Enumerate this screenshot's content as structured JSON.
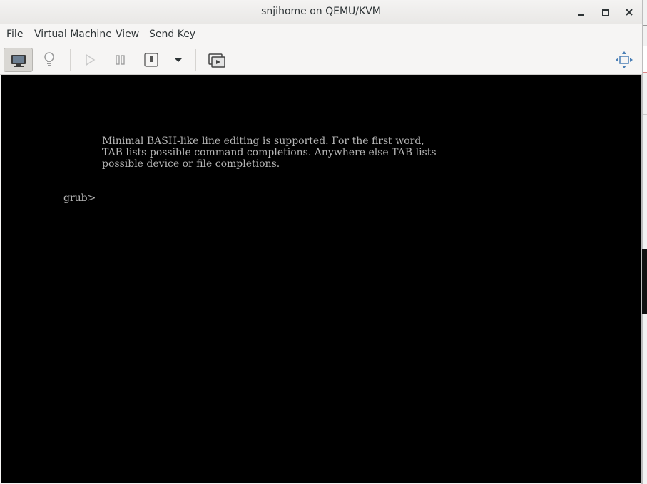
{
  "window": {
    "title": "snjihome on QEMU/KVM"
  },
  "menu": {
    "items": [
      "File",
      "Virtual Machine",
      "View",
      "Send Key"
    ]
  },
  "toolbar": {
    "icons": [
      "monitor-icon",
      "lightbulb-icon",
      "play-icon",
      "pause-icon",
      "power-icon",
      "dropdown-arrow-icon",
      "snapshot-icon",
      "fullscreen-icon"
    ]
  },
  "console": {
    "lines": [
      "Minimal BASH-like line editing is supported. For the first word,",
      "TAB lists possible command completions. Anywhere else TAB lists",
      "possible device or file completions."
    ],
    "prompt": "grub>"
  },
  "colors": {
    "console_bg": "#000000",
    "console_text": "#b5b5b5"
  }
}
